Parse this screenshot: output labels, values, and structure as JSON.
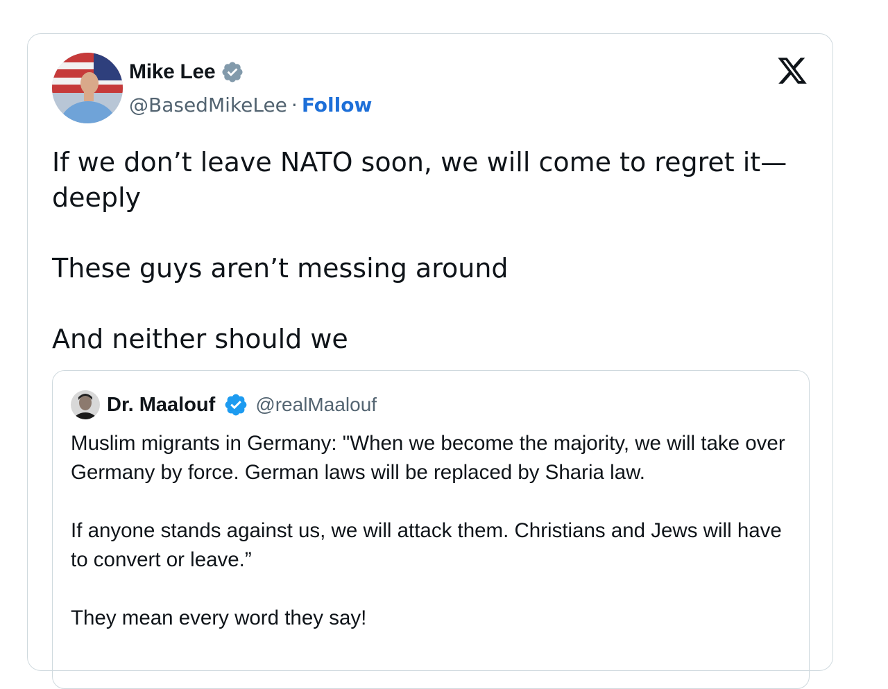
{
  "author": {
    "name": "Mike Lee",
    "handle": "@BasedMikeLee",
    "separator": "·",
    "follow_label": "Follow"
  },
  "post": {
    "line1": "If we don’t leave NATO soon, we will come to regret it—deeply",
    "line2": "These guys aren’t messing around",
    "line3": "And neither should we"
  },
  "quoted": {
    "name": "Dr. Maalouf",
    "handle": "@realMaalouf",
    "para1": "Muslim migrants in Germany: \"When we become the majority, we will take over Germany by force. German laws will be replaced by Sharia law.",
    "para2": "If anyone stands against us, we will attack them. Christians and Jews will have to convert or leave.”",
    "para3": "They mean every word they say!"
  },
  "icons": {
    "verified_author": "verified-badge-grey-icon",
    "verified_quoted": "verified-badge-blue-icon",
    "brand": "x-logo-icon"
  },
  "colors": {
    "follow": "#1d6fd8",
    "handle": "#536471",
    "verified_blue": "#1d9bf0",
    "verified_grey": "#829aab",
    "border": "#cfd9de"
  }
}
